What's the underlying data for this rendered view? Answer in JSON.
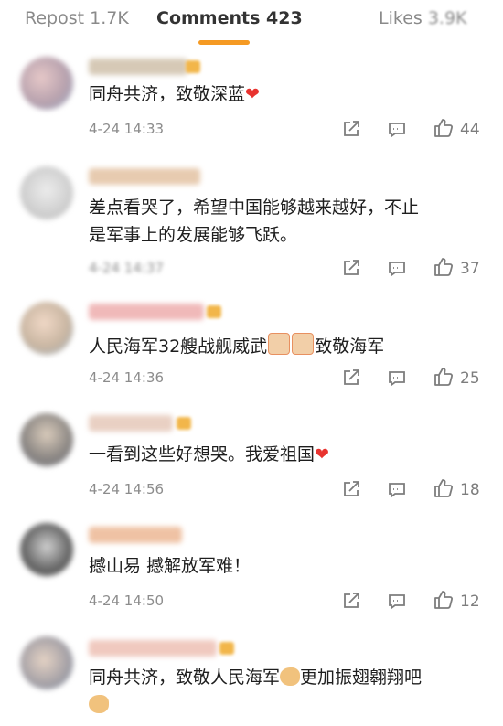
{
  "tabs": {
    "repost": "Repost 1.7K",
    "comments": "Comments 423",
    "likes_label": "Likes",
    "likes_count": "3.9K"
  },
  "colors": {
    "accent": "#f59a23",
    "heart": "#e8332f"
  },
  "comments": [
    {
      "text": "同舟共济，致敬深蓝",
      "time": "4-24 14:33",
      "likes": "44"
    },
    {
      "text_line1": "差点看哭了，希望中国能够越来越好，不止",
      "text_line2": "是军事上的发展能够飞跃。",
      "time": "4-24 14:37",
      "likes": "37"
    },
    {
      "text_a": "人民海军32艘战舰威武",
      "text_b": "致敬海军",
      "time": "4-24 14:36",
      "likes": "25"
    },
    {
      "text": "一看到这些好想哭。我爱祖国",
      "time": "4-24 14:56",
      "likes": "18"
    },
    {
      "text": "撼山易 撼解放军难！",
      "time": "4-24 14:50",
      "likes": "12"
    },
    {
      "text_a": "同舟共济，致敬人民海军",
      "text_b": "更加振翅翱翔吧"
    }
  ]
}
